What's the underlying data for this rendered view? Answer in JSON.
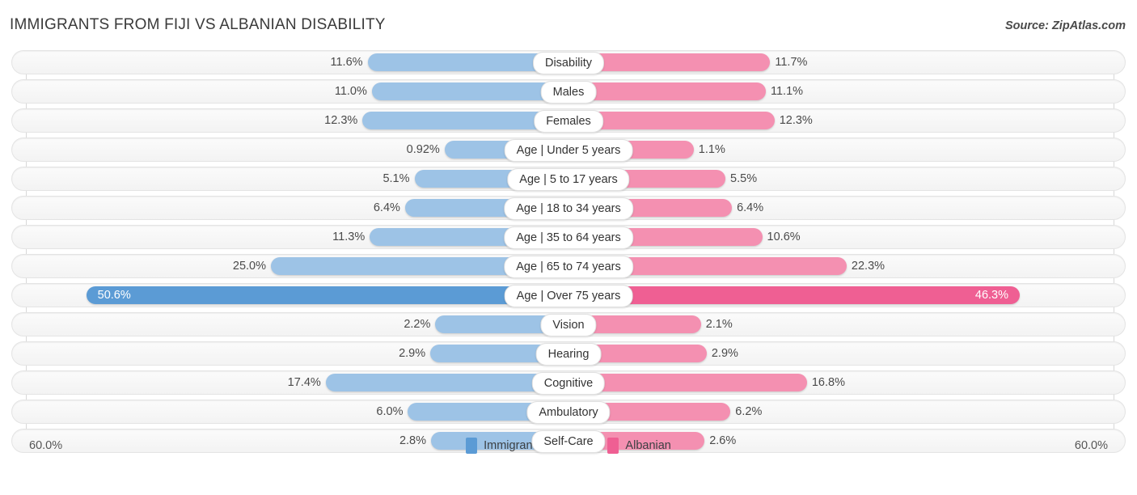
{
  "header": {
    "title": "IMMIGRANTS FROM FIJI VS ALBANIAN DISABILITY",
    "source": "Source: ZipAtlas.com"
  },
  "axis": {
    "left_max_label": "60.0%",
    "right_max_label": "60.0%"
  },
  "legend": {
    "items": [
      {
        "label": "Immigrants from Fiji",
        "color": "#5b9bd5",
        "icon": "square-swatch-blue"
      },
      {
        "label": "Albanian",
        "color": "#ef5f93",
        "icon": "square-swatch-pink"
      }
    ]
  },
  "chart_data": {
    "type": "bar",
    "subtype": "diverging-bidirectional-bar",
    "title": "IMMIGRANTS FROM FIJI VS ALBANIAN DISABILITY",
    "xlabel": "",
    "ylabel": "",
    "xlim": [
      60.0,
      60.0
    ],
    "grid": true,
    "legend_position": "bottom-center",
    "categories": [
      "Disability",
      "Males",
      "Females",
      "Age | Under 5 years",
      "Age | 5 to 17 years",
      "Age | 18 to 34 years",
      "Age | 35 to 64 years",
      "Age | 65 to 74 years",
      "Age | Over 75 years",
      "Vision",
      "Hearing",
      "Cognitive",
      "Ambulatory",
      "Self-Care"
    ],
    "series": [
      {
        "name": "Immigrants from Fiji",
        "color": "#9dc3e6",
        "highlight_color": "#5b9bd5",
        "values": [
          11.6,
          11.0,
          12.3,
          0.92,
          5.1,
          6.4,
          11.3,
          25.0,
          50.6,
          2.2,
          2.9,
          17.4,
          6.0,
          2.8
        ],
        "labels": [
          "11.6%",
          "11.0%",
          "12.3%",
          "0.92%",
          "5.1%",
          "6.4%",
          "11.3%",
          "25.0%",
          "50.6%",
          "2.2%",
          "2.9%",
          "17.4%",
          "6.0%",
          "2.8%"
        ]
      },
      {
        "name": "Albanian",
        "color": "#f490b1",
        "highlight_color": "#ef5f93",
        "values": [
          11.7,
          11.1,
          12.3,
          1.1,
          5.5,
          6.4,
          10.6,
          22.3,
          46.3,
          2.1,
          2.9,
          16.8,
          6.2,
          2.6
        ],
        "labels": [
          "11.7%",
          "11.1%",
          "12.3%",
          "1.1%",
          "5.5%",
          "6.4%",
          "10.6%",
          "22.3%",
          "46.3%",
          "2.1%",
          "2.9%",
          "16.8%",
          "6.2%",
          "2.6%"
        ]
      }
    ],
    "highlighted_category": "Age | Over 75 years"
  }
}
